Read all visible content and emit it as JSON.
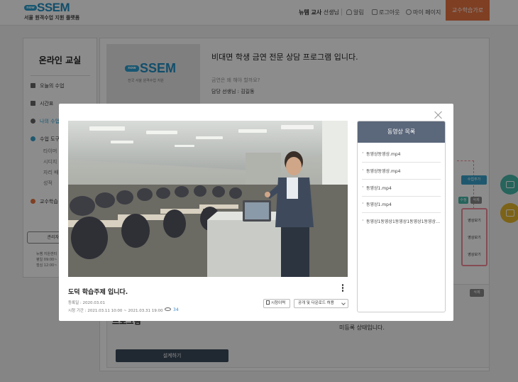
{
  "header": {
    "logo_badge": "now",
    "logo_text": "SSEM",
    "logo_subtitle": "서울 원격수업 지원 플랫폼",
    "user_name": "뉴템 교사",
    "user_suffix": "선생님",
    "links": [
      "알림",
      "로그아웃",
      "마이 페이지"
    ],
    "professor_button": "교수학습가로"
  },
  "sidebar": {
    "title": "온라인 교실",
    "items": [
      "오늘의 수업",
      "시간표",
      "나의 수업",
      "수업 도구",
      "교수학습"
    ],
    "sub_items": [
      "타이머",
      "시디지",
      "자리 배치",
      "성적"
    ],
    "password_button": "관리자 페이지",
    "footer_lines": [
      "뉴쌤 지원센터",
      "평일 09:00~",
      "점심 12:00~"
    ]
  },
  "main": {
    "thumbnail_badge": "now",
    "thumbnail_logo": "SSEM",
    "thumbnail_sub": "전국 서울 원격수업 지원",
    "program_title": "비대면 학생 금연 전문 상담 프로그램 입니다.",
    "program_question": "금연은 왜 해야 할까요?",
    "teacher_label": "담당 선생님 : 김길동",
    "add_button": "수업추가",
    "tags": [
      "수정",
      "삭제"
    ],
    "video_links": [
      "영상보기",
      "영상보기",
      "영상보기"
    ],
    "section_title": "프로그램",
    "unregistered_text": "미등록 상태입니다.",
    "delete_tag": "삭제",
    "design_button": "설계하기"
  },
  "modal": {
    "video_title": "도덕 학습주제 입니다.",
    "registered": "등록일 : 2020.03.01",
    "period": "시청 기간 : 2021.03.11 10:00 ~ 2021.03.31 19:00",
    "view_count": "34",
    "history_button": "시청이력",
    "share_select": "공개 및 다운로드 허용",
    "list_title": "동영상 목록",
    "list_items": [
      "동영상동영상.mp4",
      "동영상동영상.mp4",
      "동영상1.mp4",
      "동영상1.mp4",
      "동영상1동영상1동영상1동영상1동영상1.mp4"
    ]
  },
  "colors": {
    "accent_orange": "#e77440",
    "brand_blue": "#1f8fc3",
    "list_header": "#5b677a",
    "highlight_pink": "#f28a9a"
  }
}
